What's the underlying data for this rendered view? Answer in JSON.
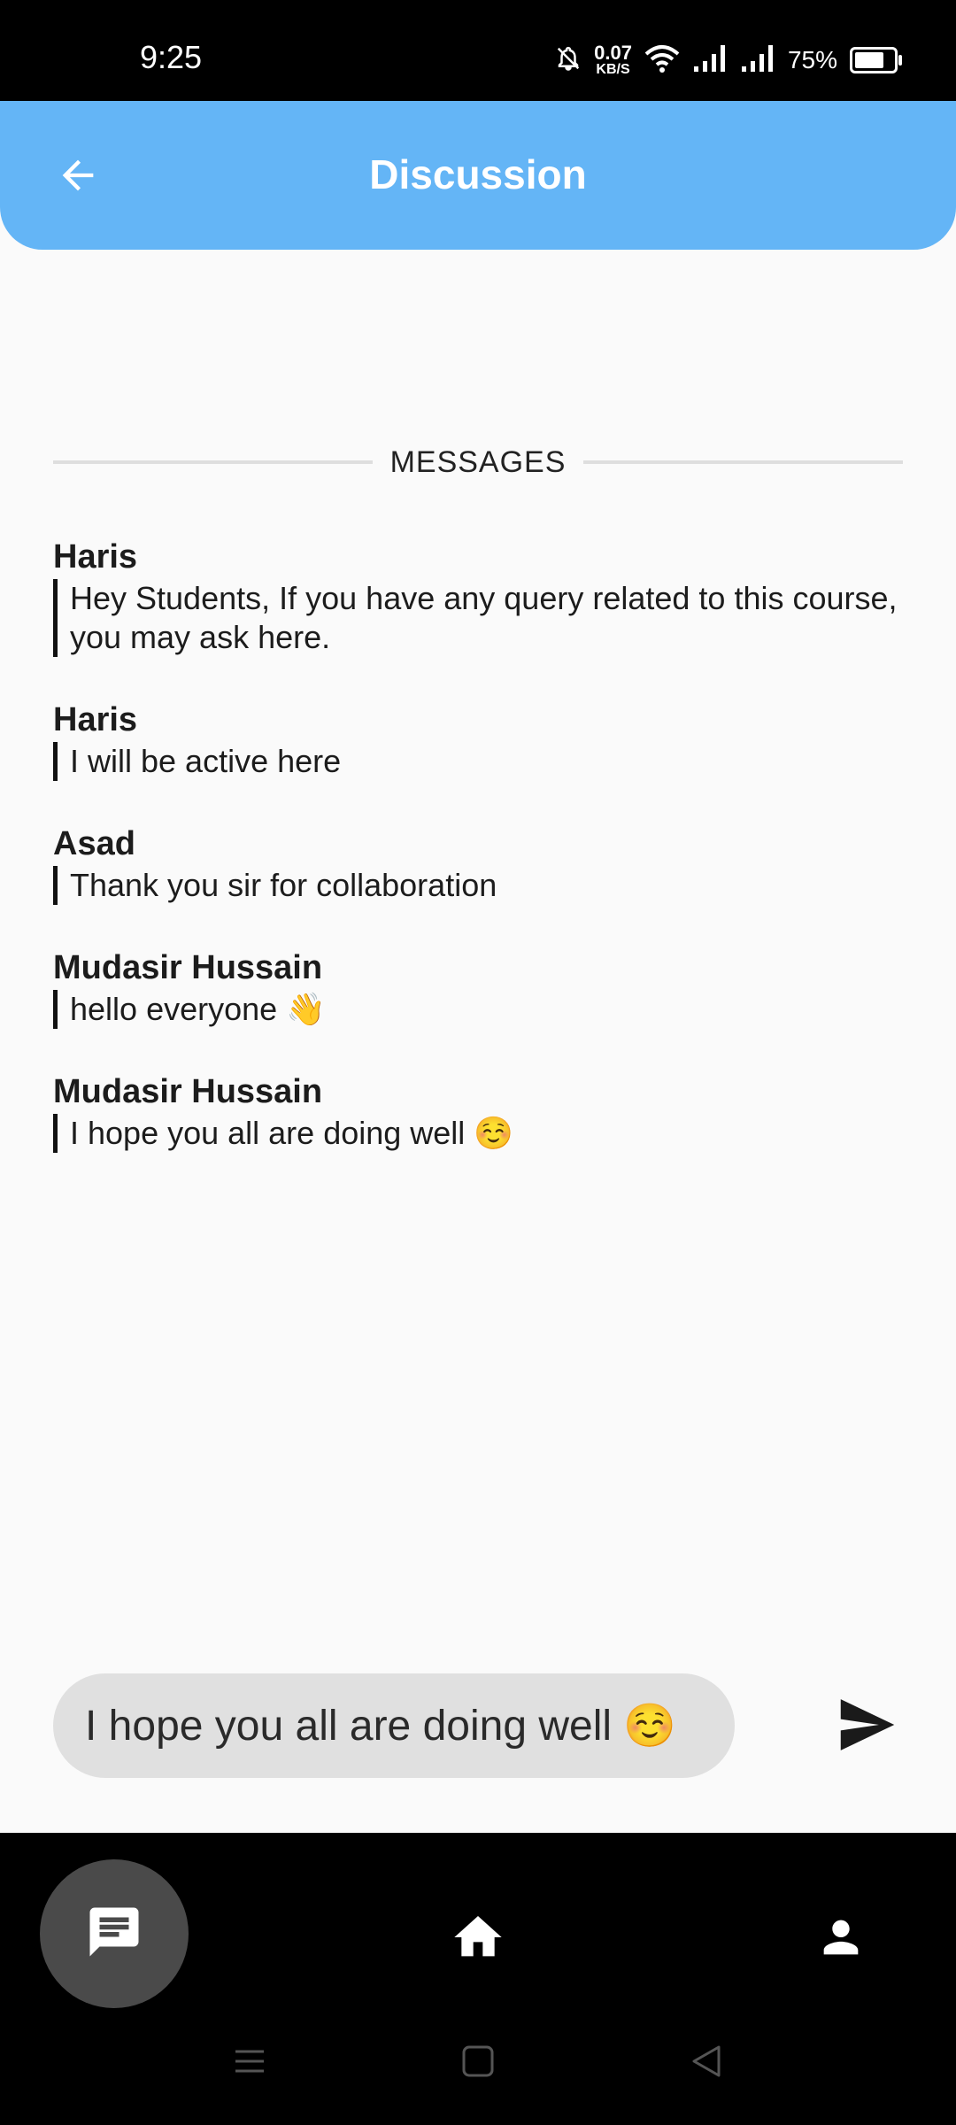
{
  "status_bar": {
    "time": "9:25",
    "net_speed_value": "0.07",
    "net_speed_unit": "KB/S",
    "battery_percent": "75%",
    "battery_level": 0.75
  },
  "header": {
    "title": "Discussion",
    "back_icon": "arrow-left-icon"
  },
  "section_label": "MESSAGES",
  "messages": [
    {
      "author": "Haris",
      "text": "Hey Students, If you have any query related to this course, you may ask here."
    },
    {
      "author": "Haris",
      "text": "I will be active here"
    },
    {
      "author": "Asad",
      "text": "Thank you sir for collaboration"
    },
    {
      "author": "Mudasir Hussain",
      "text": "hello everyone 👋"
    },
    {
      "author": "Mudasir Hussain",
      "text": "I hope you all are doing well ☺️"
    }
  ],
  "composer": {
    "value": "I hope you all are doing well ☺️",
    "send_icon": "send-icon"
  },
  "bottom_nav": {
    "items": [
      {
        "icon": "chat-icon",
        "active": true
      },
      {
        "icon": "home-icon",
        "active": false
      },
      {
        "icon": "person-icon",
        "active": false
      }
    ]
  },
  "colors": {
    "appbar": "#64b5f6",
    "background": "#fafafa",
    "input_bg": "#e0e0e0",
    "nav_bg": "#000000",
    "nav_active_bg": "#4a4a4a"
  }
}
